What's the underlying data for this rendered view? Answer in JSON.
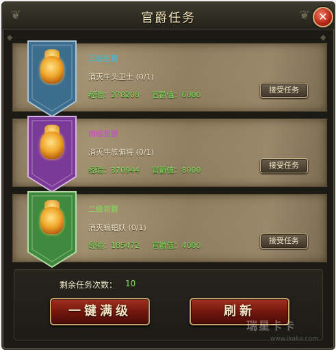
{
  "window": {
    "title": "官爵任务",
    "close_icon": "close-icon"
  },
  "tasks": [
    {
      "rank": "三级官爵",
      "rank_color": "#27c6e8",
      "banner_color": "#3c6d8e",
      "banner_dark": "#1f3e55",
      "kill": "消灭牛头卫士 (0/1)",
      "exp_label": "经验：",
      "exp_value": "278208",
      "title_label": "官爵值：",
      "title_value": "6000",
      "accept_label": "接受任务"
    },
    {
      "rank": "四级官爵",
      "rank_color": "#d13fe0",
      "banner_color": "#7b3a98",
      "banner_dark": "#42184f",
      "kill": "消灭牛族偏将 (0/1)",
      "exp_label": "经验：",
      "exp_value": "370944",
      "title_label": "官爵值：",
      "title_value": "8000",
      "accept_label": "接受任务"
    },
    {
      "rank": "二级官爵",
      "rank_color": "#7fe25a",
      "banner_color": "#3f8a3e",
      "banner_dark": "#1f4a1f",
      "kill": "消灭蝙蝠妖 (0/1)",
      "exp_label": "经验：",
      "exp_value": "185472",
      "title_label": "官爵值：",
      "title_value": "4000",
      "accept_label": "接受任务"
    }
  ],
  "footer": {
    "remain_label": "剩余任务次数：",
    "remain_value": "10",
    "max_level_label": "一键满级",
    "refresh_label": "刷新"
  },
  "watermark": {
    "brand": "瑞星卡卡",
    "url": "www.ikaka.com"
  }
}
